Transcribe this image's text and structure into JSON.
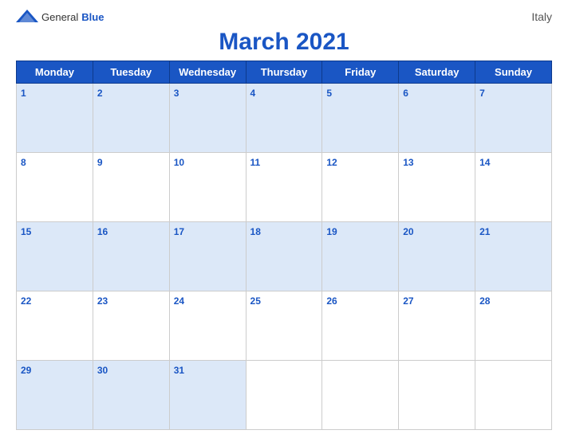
{
  "header": {
    "logo_general": "General",
    "logo_blue": "Blue",
    "title": "March 2021",
    "country": "Italy"
  },
  "days_of_week": [
    "Monday",
    "Tuesday",
    "Wednesday",
    "Thursday",
    "Friday",
    "Saturday",
    "Sunday"
  ],
  "weeks": [
    [
      1,
      2,
      3,
      4,
      5,
      6,
      7
    ],
    [
      8,
      9,
      10,
      11,
      12,
      13,
      14
    ],
    [
      15,
      16,
      17,
      18,
      19,
      20,
      21
    ],
    [
      22,
      23,
      24,
      25,
      26,
      27,
      28
    ],
    [
      29,
      30,
      31,
      null,
      null,
      null,
      null
    ]
  ]
}
